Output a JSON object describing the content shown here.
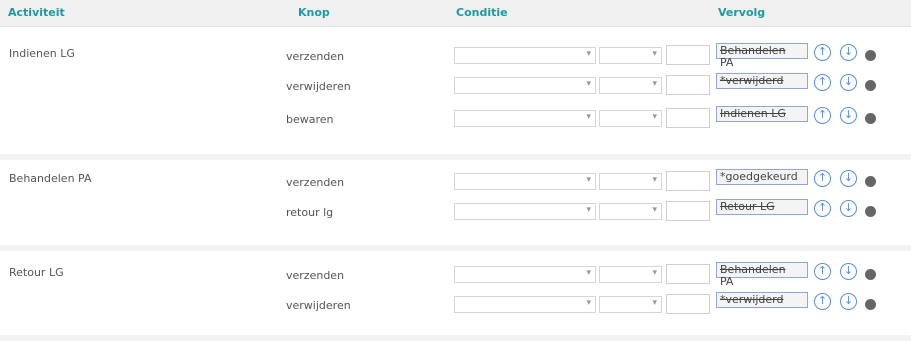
{
  "header": {
    "activiteit": "Activiteit",
    "knop": "Knop",
    "conditie": "Conditie",
    "vervolg": "Vervolg"
  },
  "groups": [
    {
      "activity": "Indienen LG",
      "rows": [
        {
          "knop": "verzenden",
          "vervolg": "Behandelen",
          "vervolg_wrap": "PA"
        },
        {
          "knop": "verwijderen",
          "vervolg": "*verwijderd",
          "vervolg_wrap": ""
        },
        {
          "knop": "bewaren",
          "vervolg": "Indienen LG",
          "vervolg_wrap": ""
        }
      ]
    },
    {
      "activity": "Behandelen PA",
      "rows": [
        {
          "knop": "verzenden",
          "vervolg": "*goedgekeurd",
          "vervolg_wrap": ""
        },
        {
          "knop": "retour lg",
          "vervolg": "Retour LG",
          "vervolg_wrap": ""
        }
      ]
    },
    {
      "activity": "Retour LG",
      "rows": [
        {
          "knop": "verzenden",
          "vervolg": "Behandelen",
          "vervolg_wrap": "PA"
        },
        {
          "knop": "verwijderen",
          "vervolg": "*verwijderd",
          "vervolg_wrap": ""
        }
      ]
    }
  ],
  "icons": {
    "chevron": "chevron-down-icon",
    "up": "arrow-up-icon",
    "down": "arrow-down-icon",
    "delete": "delete-icon"
  },
  "colors": {
    "header_text": "#1f9aa0",
    "button_border": "#5b8fd6",
    "vervolg_border": "#8ea8d6"
  }
}
